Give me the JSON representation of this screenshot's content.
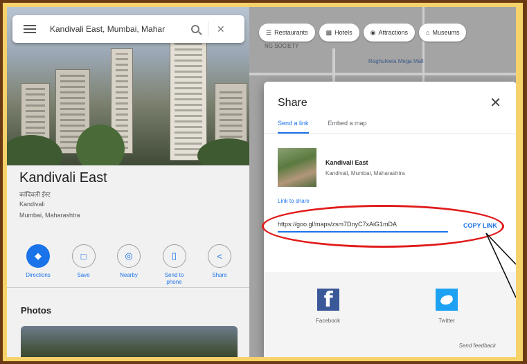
{
  "search": {
    "value": "Kandivali East, Mumbai, Mahar"
  },
  "categories": [
    {
      "icon": "fork-knife-icon",
      "label": "Restaurants"
    },
    {
      "icon": "bed-icon",
      "label": "Hotels"
    },
    {
      "icon": "camera-icon",
      "label": "Attractions"
    },
    {
      "icon": "museum-icon",
      "label": "Museums"
    }
  ],
  "place": {
    "name": "Kandivali East",
    "native_name": "कांदिवली ईस्ट",
    "locality": "Kandivali",
    "region": "Mumbai, Maharashtra"
  },
  "actions": [
    {
      "icon": "directions-icon",
      "label": "Directions"
    },
    {
      "icon": "bookmark-icon",
      "label": "Save"
    },
    {
      "icon": "nearby-icon",
      "label": "Nearby"
    },
    {
      "icon": "phone-icon",
      "label": "Send to phone"
    },
    {
      "icon": "share-icon",
      "label": "Share"
    }
  ],
  "photos_heading": "Photos",
  "map": {
    "label_society": "NG SOCIETY",
    "label_mall": "Raghuleela Mega Mall"
  },
  "share": {
    "title": "Share",
    "tabs": [
      "Send a link",
      "Embed a map"
    ],
    "active_tab": 0,
    "place_name": "Kandivali East",
    "place_address": "Kandivali, Mumbai, Maharashtra",
    "link_label": "Link to share",
    "link_value": "https://goo.gl/maps/zsm7DnyC7xAiG1mDA",
    "copy_label": "COPY LINK",
    "social": [
      {
        "icon": "facebook-icon",
        "label": "Facebook"
      },
      {
        "icon": "twitter-icon",
        "label": "Twitter"
      }
    ],
    "feedback": "Send feedback"
  },
  "colors": {
    "accent": "#1a73e8",
    "annotation": "#e11b1b",
    "frame": "#f6d26a",
    "border": "#6b3a12"
  }
}
